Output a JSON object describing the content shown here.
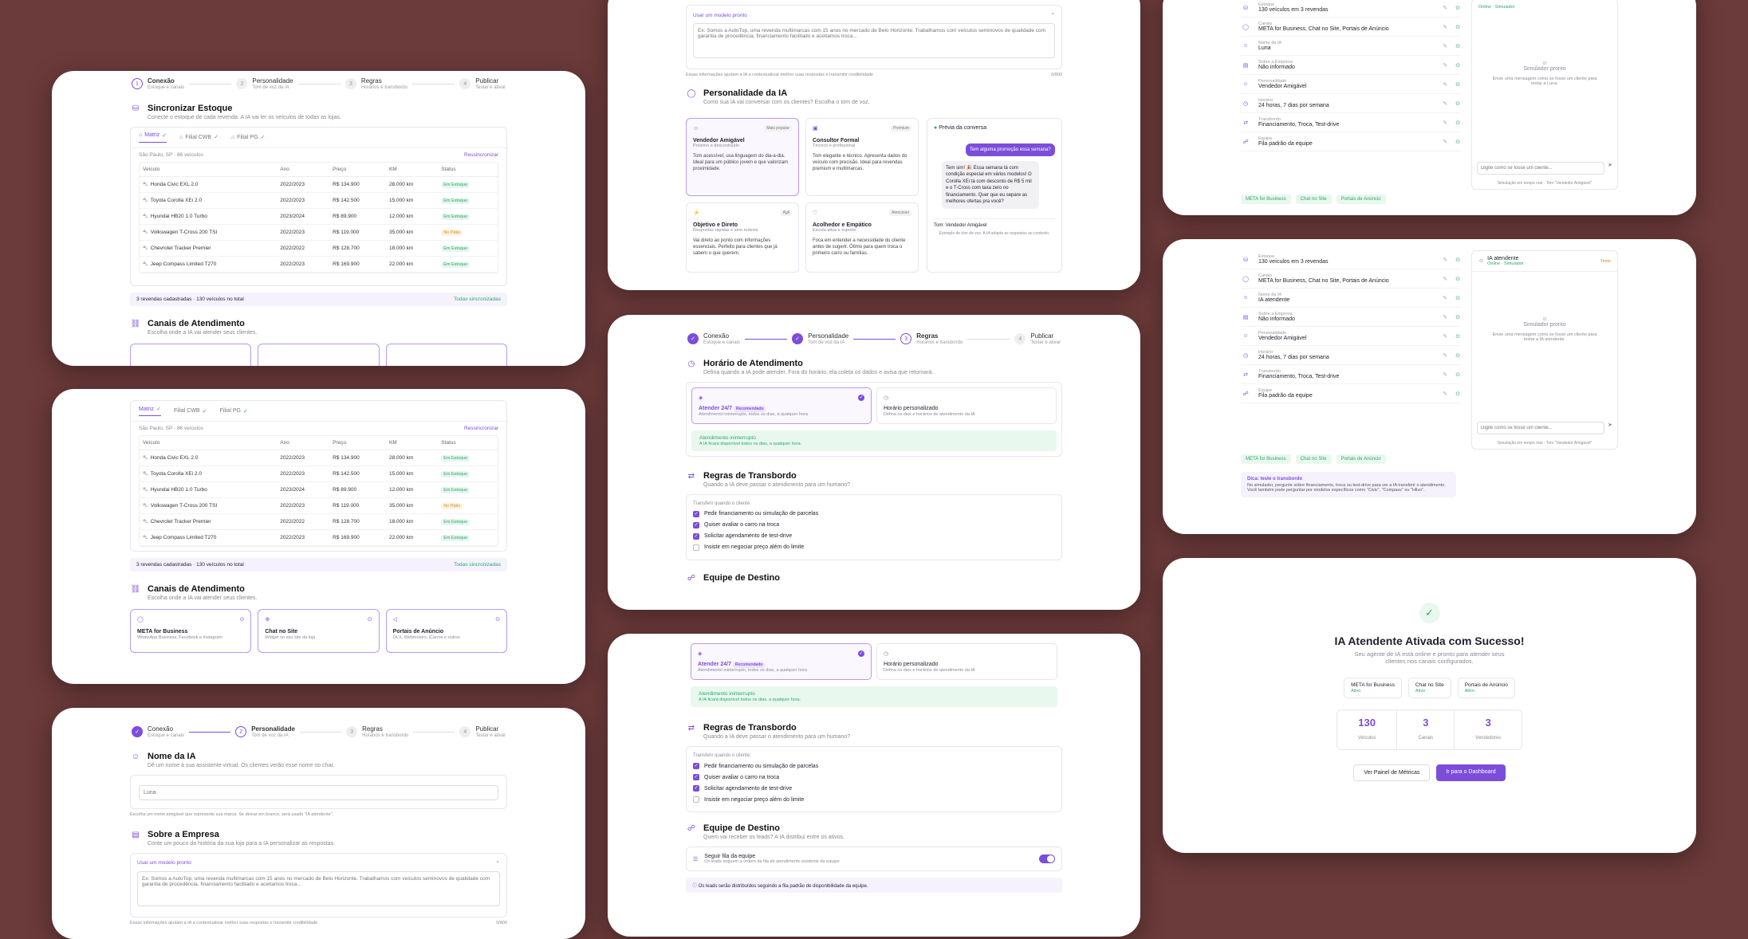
{
  "steps": [
    {
      "label": "Conexão",
      "sub": "Estoque e canais"
    },
    {
      "label": "Personalidade",
      "sub": "Tom de voz da IA"
    },
    {
      "label": "Regras",
      "sub": "Horários e transbordo"
    },
    {
      "label": "Publicar",
      "sub": "Testar e ativar"
    }
  ],
  "sync": {
    "title": "Sincronizar Estoque",
    "desc": "Conecte o estoque de cada revenda. A IA vai ler os veículos de todas as lojas.",
    "tabs": [
      "Matriz",
      "Filial CWB",
      "Filial PG"
    ],
    "location": "São Paulo, SP · 86 veículos",
    "resync": "Ressincronizar",
    "headers": [
      "Veículo",
      "Ano",
      "Preço",
      "KM",
      "Status"
    ],
    "rows": [
      [
        "Honda Civic EXL 2.0",
        "2022/2023",
        "R$ 134.900",
        "28.000 km",
        "Em Estoque"
      ],
      [
        "Toyota Corolla XEi 2.0",
        "2022/2023",
        "R$ 142.500",
        "15.000 km",
        "Em Estoque"
      ],
      [
        "Hyundai HB20 1.0 Turbo",
        "2023/2024",
        "R$ 89.900",
        "12.000 km",
        "Em Estoque"
      ],
      [
        "Volkswagen T-Cross 200 TSI",
        "2022/2023",
        "R$ 119.000",
        "35.000 km",
        "No Pátio"
      ],
      [
        "Chevrolet Tracker Premier",
        "2022/2022",
        "R$ 128.700",
        "18.000 km",
        "Em Estoque"
      ],
      [
        "Jeep Compass Limited T270",
        "2022/2023",
        "R$ 169.900",
        "22.000 km",
        "Em Estoque"
      ]
    ],
    "summary": "3 revendas cadastradas · 130 veículos no total",
    "synced": "Todas sincronizadas"
  },
  "channels": {
    "title": "Canais de Atendimento",
    "desc": "Escolha onde a IA vai atender seus clientes.",
    "items": [
      {
        "name": "META for Business",
        "sub": "WhatsApp Business, Facebook e Instagram"
      },
      {
        "name": "Chat no Site",
        "sub": "Widget no seu site da loja"
      },
      {
        "name": "Portais de Anúncio",
        "sub": "OLX, Webmotors, iCarros e outros"
      }
    ]
  },
  "name": {
    "title": "Nome da IA",
    "desc": "Dê um nome à sua assistente virtual. Os clientes verão esse nome no chat.",
    "placeholder": "Luna",
    "hint": "Escolha um nome amigável que represente sua marca. Se deixar em branco, será usado \"IA atendente\"."
  },
  "company": {
    "title": "Sobre a Empresa",
    "desc": "Conte um pouco da história da sua loja para a IA personalizar as respostas.",
    "template": "Usar um modelo pronto",
    "placeholder": "Ex: Somos a AutoTop, uma revenda multimarcas com 15 anos no mercado de Belo Horizonte. Trabalhamos com veículos seminovos de qualidade com garantia de procedência, financiamento facilitado e aceitamos troca...",
    "hint": "Essas informações ajudam a IA a contextualizar melhor suas respostas e transmitir credibilidade",
    "count": "0/800"
  },
  "persona": {
    "title": "Personalidade da IA",
    "desc": "Como sua IA vai conversar com os clientes? Escolha o tom de voz.",
    "items": [
      {
        "name": "Vendedor Amigável",
        "sub": "Próximo e descontraído",
        "tag": "Mais popular",
        "text": "Tom acessível, usa linguagem do dia-a-dia. Ideal para um público jovem e que valorizam proximidade."
      },
      {
        "name": "Consultor Formal",
        "sub": "Técnico e profissional",
        "tag": "Premium",
        "text": "Tom elegante e técnico. Apresenta dados do veículo com precisão. Ideal para revendas premium e multimarcas."
      },
      {
        "name": "Objetivo e Direto",
        "sub": "Respostas rápidas e sem rodeios",
        "tag": "Ágil",
        "text": "Vai direto ao ponto com informações essenciais. Perfeito para clientes que já sabem o que querem."
      },
      {
        "name": "Acolhedor e Empático",
        "sub": "Escuta ativa e suporte",
        "tag": "Atencioso",
        "text": "Foca em entender a necessidade do cliente antes de sugerir. Ótimo para quem troca o primeiro carro ou famílias."
      }
    ],
    "preview": "Prévia da conversa",
    "q": "Tem alguma promoção essa semana?",
    "a": "Tem sim! 🎉 Essa semana tá com condição especial em vários modelos! O Corolla XEi tá com desconto de R$ 5 mil e o T-Cross com taxa zero no financiamento. Quer que eu separe as melhores ofertas pra você?",
    "tone": "Tom: Vendedor Amigável",
    "foot": "Exemplo de tom de voz. A IA adapta as respostas ao contexto."
  },
  "hours": {
    "title": "Horário de Atendimento",
    "desc": "Defina quando a IA pode atender. Fora do horário, ela coleta os dados e avisa que retornará.",
    "a": "Atender 24/7",
    "atag": "Recomendado",
    "asub": "Atendimento ininterrupto, todos os dias, a qualquer hora",
    "b": "Horário personalizado",
    "bsub": "Defina os dias e horários de atendimento da IA",
    "note": "Atendimento ininterrupto",
    "notesub": "A IA ficará disponível todos os dias, a qualquer hora."
  },
  "handoff": {
    "title": "Regras de Transbordo",
    "desc": "Quando a IA deve passar o atendimento para um humano?",
    "label": "Transferir quando o cliente:",
    "items": [
      {
        "t": "Pedir financiamento ou simulação de parcelas",
        "on": true
      },
      {
        "t": "Quiser avaliar o carro na troca",
        "on": true
      },
      {
        "t": "Solicitar agendamento de test-drive",
        "on": true
      },
      {
        "t": "Insistir em negociar preço além do limite",
        "on": false
      }
    ]
  },
  "team": {
    "title": "Equipe de Destino",
    "desc": "Quem vai receber os leads? A IA distribui entre os ativos.",
    "rule": "Seguir fila da equipe",
    "rulesub": "Os leads seguem a ordem da fila de atendimento existente da equipe",
    "note": "Os leads serão distribuídos seguindo a fila padrão de disponibilidade da equipe."
  },
  "review": {
    "items": [
      {
        "k": "Estoque",
        "v": "130 veículos em 3 revendas"
      },
      {
        "k": "Canais",
        "v": "META for Business, Chat no Site, Portais de Anúncio"
      },
      {
        "k": "Nome da IA",
        "v": "Luna"
      },
      {
        "k": "Sobre a Empresa",
        "v": "Não informado"
      },
      {
        "k": "Personalidade",
        "v": "Vendedor Amigável"
      },
      {
        "k": "Horário",
        "v": "24 horas, 7 dias por semana"
      },
      {
        "k": "Transbordo",
        "v": "Financiamento, Troca, Test-drive"
      },
      {
        "k": "Equipe",
        "v": "Fila padrão da equipe"
      }
    ],
    "name2": "IA atendente",
    "chips": [
      "META for Business",
      "Chat no Site",
      "Portais de Anúncio"
    ],
    "sim_title": "IA atendente",
    "sim_status": "Online · Simulador",
    "sim_tag": "Teste",
    "sim_ready": "Simulador pronto",
    "sim_desc": "Envie uma mensagem como se fosse um cliente para testar a Luna.",
    "sim_desc2": "Envie uma mensagem como se fosse um cliente para testar a IA atendente.",
    "sim_input": "Digite como se fosse um cliente...",
    "sim_foot": "Simulação em tempo real · Tom \"Vendedor Amigável\"",
    "tip_title": "Dica: teste o transbordo",
    "tip": "No simulador, pergunte sobre financiamento, troca ou test-drive para ver a IA transferir o atendimento. Você também pode perguntar por modelos específicos como \"Civic\", \"Compass\" ou \"Hilux\"."
  },
  "success": {
    "title": "IA Atendente Ativada com Sucesso!",
    "desc": "Seu agente de IA está online e pronto para atender seus clientes nos canais configurados.",
    "chips": [
      {
        "n": "META for Business",
        "s": "Ativo"
      },
      {
        "n": "Chat no Site",
        "s": "Ativo"
      },
      {
        "n": "Portais de Anúncio",
        "s": "Ativo"
      }
    ],
    "stats": [
      {
        "v": "130",
        "l": "Veículos"
      },
      {
        "v": "3",
        "l": "Canais"
      },
      {
        "v": "3",
        "l": "Vendedores"
      }
    ],
    "btn1": "Ver Painel de Métricas",
    "btn2": "Ir para o Dashboard"
  }
}
